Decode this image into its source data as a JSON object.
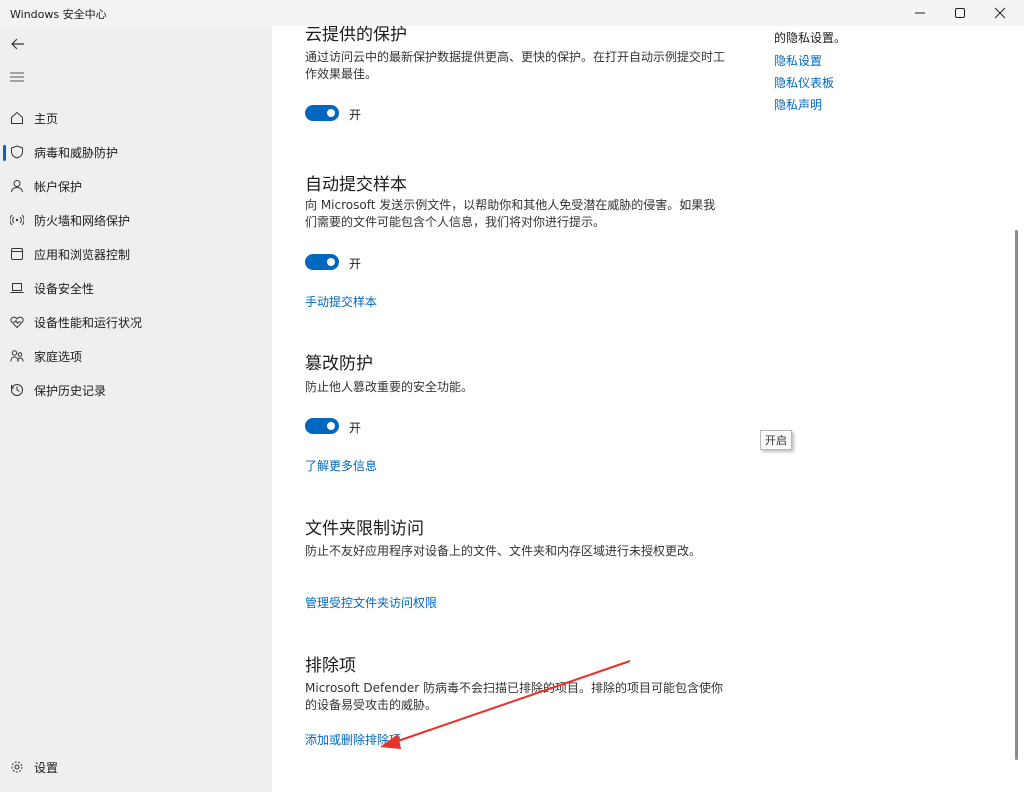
{
  "window": {
    "title": "Windows 安全中心",
    "controls": [
      "minimize-icon",
      "maximize-icon",
      "close-icon"
    ]
  },
  "sidebar": {
    "items": [
      {
        "label": "主页",
        "icon": "home-icon"
      },
      {
        "label": "病毒和威胁防护",
        "icon": "shield-icon",
        "active": true
      },
      {
        "label": "帐户保护",
        "icon": "person-icon"
      },
      {
        "label": "防火墙和网络保护",
        "icon": "wifi-icon"
      },
      {
        "label": "应用和浏览器控制",
        "icon": "app-browser-icon"
      },
      {
        "label": "设备安全性",
        "icon": "laptop-icon"
      },
      {
        "label": "设备性能和运行状况",
        "icon": "heart-icon"
      },
      {
        "label": "家庭选项",
        "icon": "family-icon"
      },
      {
        "label": "保护历史记录",
        "icon": "history-icon"
      }
    ],
    "settings_label": "设置"
  },
  "main": {
    "cloud": {
      "title": "云提供的保护",
      "desc": "通过访问云中的最新保护数据提供更高、更快的保护。在打开自动示例提交时工作效果最佳。",
      "toggle_label": "开"
    },
    "sample": {
      "title": "自动提交样本",
      "desc": "向 Microsoft 发送示例文件，以帮助你和其他人免受潜在威胁的侵害。如果我们需要的文件可能包含个人信息，我们将对你进行提示。",
      "toggle_label": "开",
      "link": "手动提交样本"
    },
    "tamper": {
      "title": "篡改防护",
      "desc": "防止他人篡改重要的安全功能。",
      "toggle_label": "开",
      "link": "了解更多信息"
    },
    "folder": {
      "title": "文件夹限制访问",
      "desc": "防止不友好应用程序对设备上的文件、文件夹和内存区域进行未授权更改。",
      "link": "管理受控文件夹访问权限"
    },
    "exclusions": {
      "title": "排除项",
      "desc": "Microsoft Defender 防病毒不会扫描已排除的项目。排除的项目可能包含使你的设备易受攻击的威胁。",
      "link": "添加或删除排除项"
    }
  },
  "right": {
    "privacy_text": "的隐私设置。",
    "links": [
      "隐私设置",
      "隐私仪表板",
      "隐私声明"
    ]
  },
  "tooltip": "开启",
  "colors": {
    "accent": "#0067c0",
    "sidebar_bg": "#efefef",
    "arrow": "#e8322c"
  }
}
